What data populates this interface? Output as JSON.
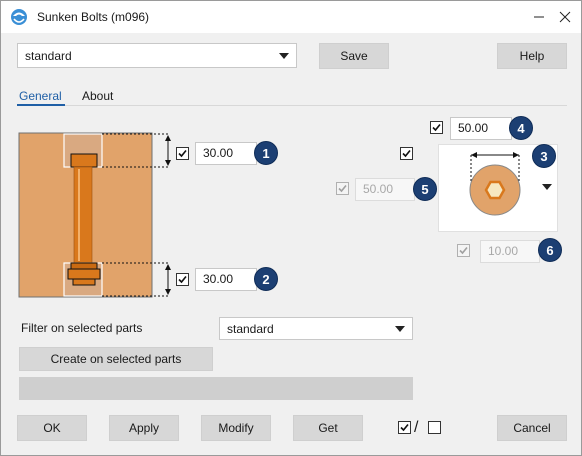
{
  "window": {
    "title": "Sunken Bolts (m096)"
  },
  "top": {
    "preset_value": "standard",
    "save_label": "Save",
    "help_label": "Help"
  },
  "tabs": [
    {
      "label": "General"
    },
    {
      "label": "About"
    }
  ],
  "params": {
    "p1": {
      "value": "30.00",
      "badge": "1"
    },
    "p2": {
      "value": "30.00",
      "badge": "2"
    },
    "p3": {
      "badge": "3"
    },
    "p4": {
      "value": "50.00",
      "badge": "4"
    },
    "p5": {
      "value": "50.00",
      "badge": "5"
    },
    "p6": {
      "value": "10.00",
      "badge": "6"
    }
  },
  "filter": {
    "label": "Filter on selected parts",
    "value": "standard"
  },
  "actions": {
    "create_label": "Create on selected parts"
  },
  "bottom": {
    "ok_label": "OK",
    "apply_label": "Apply",
    "modify_label": "Modify",
    "get_label": "Get",
    "toggle_separator": "/",
    "cancel_label": "Cancel"
  },
  "colors": {
    "plate": "#e1a36a",
    "bolt": "#d9781c",
    "badge": "#1c3f73",
    "accent": "#1f5fa6"
  },
  "icons": [
    "app-icon",
    "minimize-icon",
    "close-icon",
    "check-icon",
    "dropdown-arrow-icon"
  ]
}
